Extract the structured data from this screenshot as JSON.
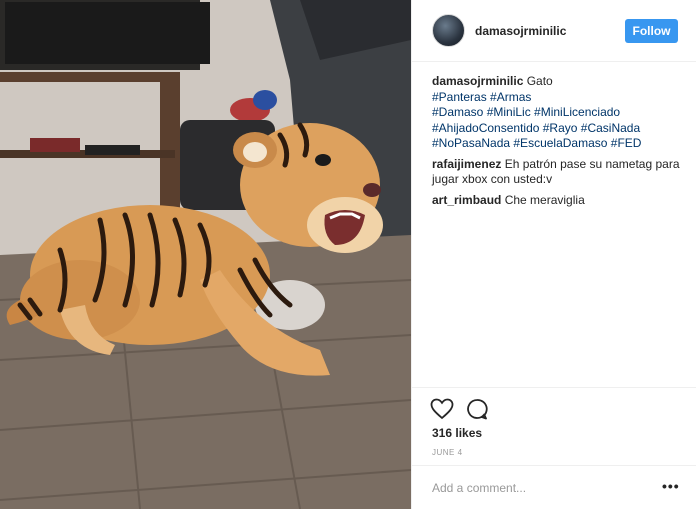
{
  "post": {
    "image_alt": "Tiger cub snarling on a wooden floor"
  },
  "header": {
    "username": "damasojrminilic",
    "follow_label": "Follow"
  },
  "caption": {
    "username": "damasojrminilic",
    "text": "Gato",
    "hashtags_lines": [
      "#Panteras #Armas",
      "#Damaso #MiniLic #MiniLicenciado",
      "#AhijadoConsentido #Rayo #CasiNada",
      "#NoPasaNada #EscuelaDamaso #FED"
    ]
  },
  "comments": [
    {
      "username": "rafaijimenez",
      "text": "Eh patrón pase su nametag para jugar xbox con usted:v"
    },
    {
      "username": "art_rimbaud",
      "text": "Che meraviglia"
    }
  ],
  "actions": {
    "like_icon": "heart-icon",
    "comment_icon": "comment-icon",
    "likes": "316 likes",
    "date": "JUNE 4"
  },
  "add_comment": {
    "placeholder": "Add a comment...",
    "more_label": "•••"
  },
  "colors": {
    "follow_bg": "#3897f0",
    "hashtag": "#003569",
    "muted": "#999999"
  }
}
